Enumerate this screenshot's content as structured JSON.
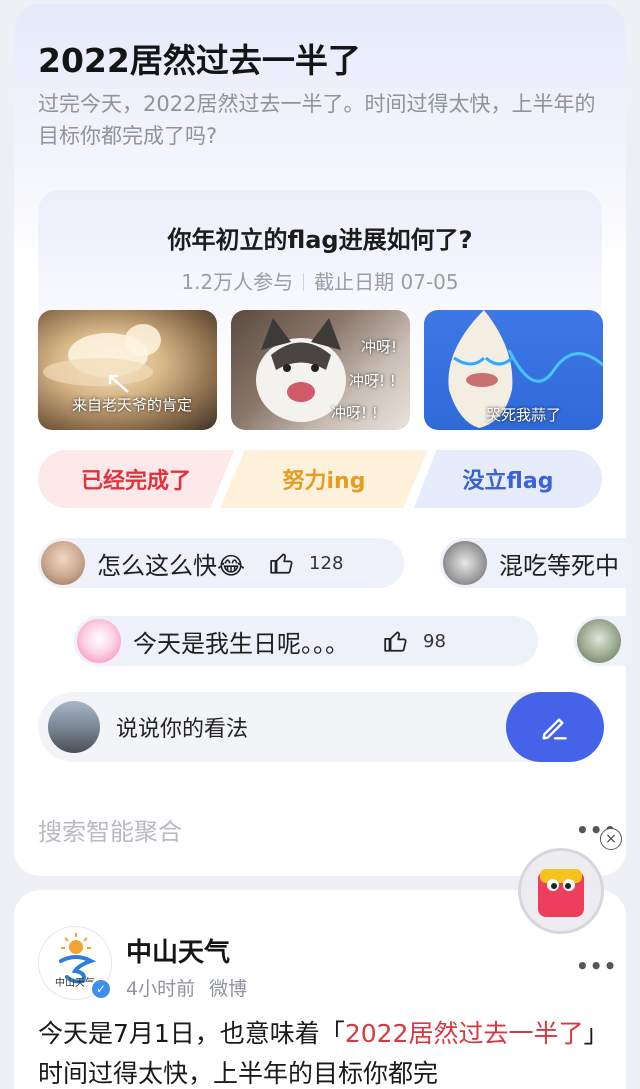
{
  "topic": {
    "title": "2022居然过去一半了",
    "description": "过完今天，2022居然过去一半了。时间过得太快，上半年的目标你都完成了吗?"
  },
  "poll": {
    "question": "你年初立的flag进展如何了?",
    "participants": "1.2万人参与",
    "deadline": "截止日期 07-05",
    "images": [
      {
        "caption": "来自老天爷的肯定"
      },
      {
        "captions": [
          "冲呀!",
          "冲呀! !",
          "冲呀! !"
        ]
      },
      {
        "caption": "哭死我蒜了"
      }
    ],
    "options": [
      {
        "label": "已经完成了",
        "color": "#e4323d"
      },
      {
        "label": "努力ing",
        "color": "#e59d1d"
      },
      {
        "label": "没立flag",
        "color": "#3b62d8"
      }
    ]
  },
  "danmaku": [
    {
      "text": "怎么这么快😂",
      "likes": "128"
    },
    {
      "text": "混吃等死中"
    },
    {
      "text": "今天是我生日呢。。。",
      "likes": "98"
    }
  ],
  "comment_box": {
    "placeholder": "说说你的看法"
  },
  "aggregation": {
    "label": "搜索智能聚合",
    "more": "•••"
  },
  "post": {
    "account": "中山天气",
    "logo_text": "中山天气",
    "time": "4小时前",
    "source": "微博",
    "more": "•••",
    "text_before": "今天是7月1日，也意味着「",
    "text_highlight": "2022居然过去一半了",
    "text_after": "」时间过得太快，上半年的目标你都完",
    "highlight_color": "#d6393f"
  },
  "float_widget": {
    "close": "×"
  }
}
